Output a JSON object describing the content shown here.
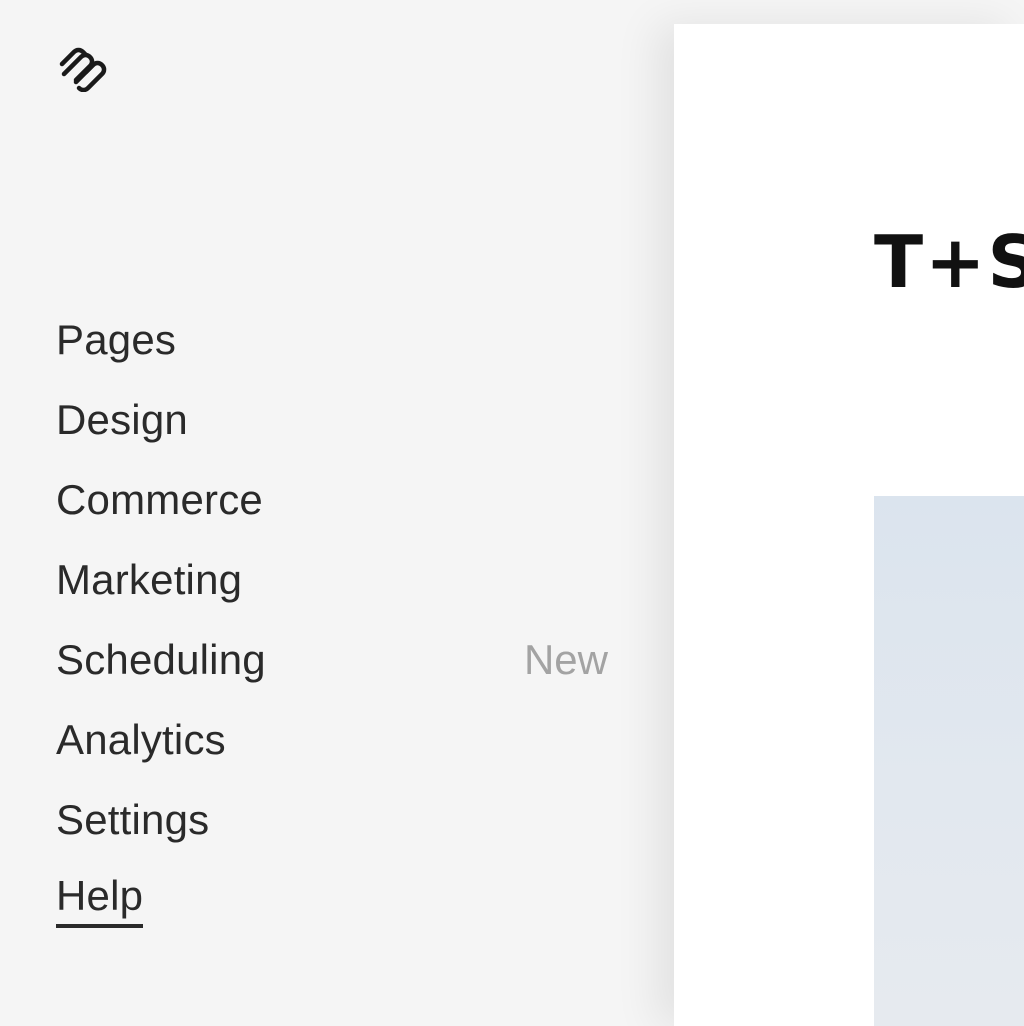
{
  "app": {
    "logo_icon": "squarespace-logo-icon"
  },
  "sidebar": {
    "items": [
      {
        "label": "Pages",
        "badge": ""
      },
      {
        "label": "Design",
        "badge": ""
      },
      {
        "label": "Commerce",
        "badge": ""
      },
      {
        "label": "Marketing",
        "badge": ""
      },
      {
        "label": "Scheduling",
        "badge": "New"
      },
      {
        "label": "Analytics",
        "badge": ""
      },
      {
        "label": "Settings",
        "badge": ""
      },
      {
        "label": "Help",
        "badge": ""
      }
    ]
  },
  "preview": {
    "site_title": "T+S"
  },
  "colors": {
    "sidebar_bg": "#f5f5f5",
    "text": "#2a2a2a",
    "badge_text": "#a3a3a3",
    "preview_bg": "#ffffff"
  }
}
